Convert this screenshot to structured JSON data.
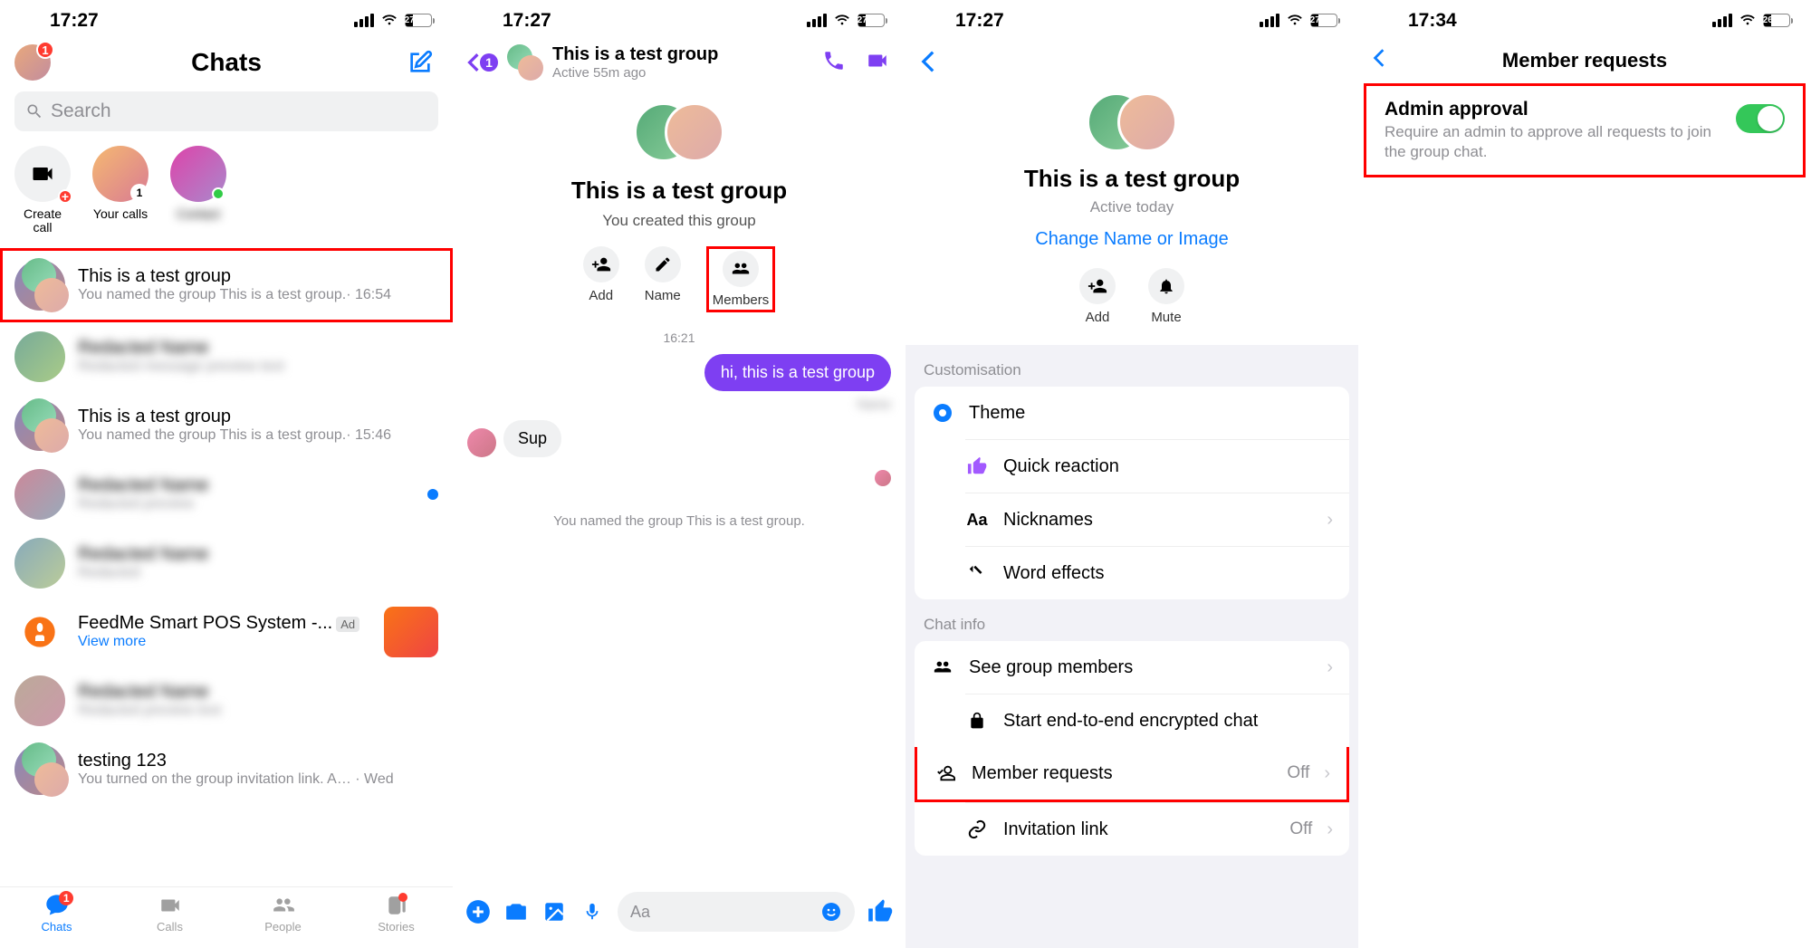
{
  "status": {
    "time1": "17:27",
    "time4": "17:34",
    "battery1": "27",
    "battery4": "26"
  },
  "screen1": {
    "title": "Chats",
    "badge": "1",
    "search_placeholder": "Search",
    "stories": {
      "create": "Create call",
      "your_calls": "Your calls"
    },
    "chats": [
      {
        "name": "This is a test group",
        "preview": "You named the group This is a test group.· 16:54"
      },
      {
        "name": "This is a test group",
        "preview": "You named the group This is a test group.· 15:46"
      },
      {
        "name": "FeedMe Smart POS System -...",
        "view_more": "View more",
        "ad": "Ad"
      },
      {
        "name": "testing 123",
        "preview": "You turned on the group invitation link. A… · Wed"
      }
    ],
    "tabs": {
      "chats": "Chats",
      "calls": "Calls",
      "people": "People",
      "stories": "Stories",
      "badge": "1"
    }
  },
  "screen2": {
    "back_badge": "1",
    "title": "This is a test group",
    "subtitle": "Active 55m ago",
    "group_title": "This is a test group",
    "group_sub": "You created this group",
    "actions": {
      "add": "Add",
      "name": "Name",
      "members": "Members"
    },
    "ts": "16:21",
    "bubble_right": "hi, this is a test group",
    "bubble_left": "Sup",
    "system": "You named the group This is a test group.",
    "composer_placeholder": "Aa"
  },
  "screen3": {
    "group_title": "This is a test group",
    "group_sub": "Active today",
    "change": "Change Name or Image",
    "actions": {
      "add": "Add",
      "mute": "Mute"
    },
    "sections": {
      "customisation": "Customisation",
      "chat_info": "Chat info"
    },
    "rows": {
      "theme": "Theme",
      "quick_reaction": "Quick reaction",
      "nicknames": "Nicknames",
      "word_effects": "Word effects",
      "see_members": "See group members",
      "e2e": "Start end-to-end encrypted chat",
      "member_requests": "Member requests",
      "member_requests_val": "Off",
      "invitation": "Invitation link",
      "invitation_val": "Off"
    }
  },
  "screen4": {
    "title": "Member requests",
    "setting_title": "Admin approval",
    "setting_desc": "Require an admin to approve all requests to join the group chat."
  }
}
